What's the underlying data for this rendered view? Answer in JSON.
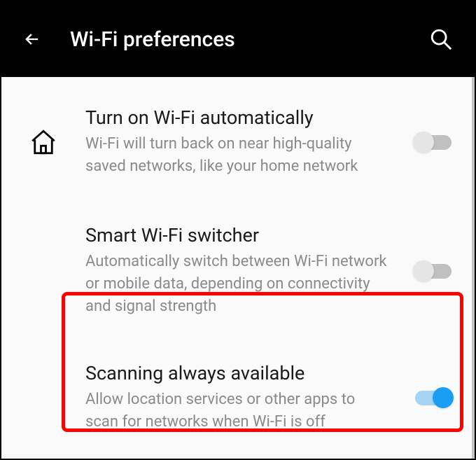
{
  "header": {
    "title": "Wi-Fi preferences"
  },
  "settings": [
    {
      "title": "Turn on Wi-Fi automatically",
      "desc": "Wi-Fi will turn back on near high-quality saved networks, like your home network",
      "state": "off"
    },
    {
      "title": "Smart Wi-Fi switcher",
      "desc": "Automatically switch between Wi-Fi network or mobile data, depending on connectivity and signal strength",
      "state": "off"
    },
    {
      "title": "Scanning always available",
      "desc": "Allow location services or other apps to scan for networks when Wi-Fi is off",
      "state": "on"
    }
  ]
}
